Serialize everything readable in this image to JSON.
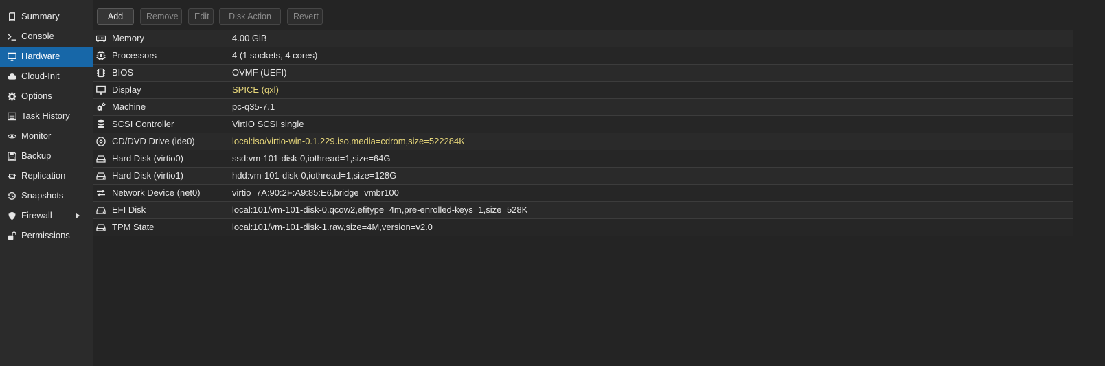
{
  "sidebar": {
    "items": [
      {
        "label": "Summary",
        "icon": "book-icon",
        "active": false
      },
      {
        "label": "Console",
        "icon": "terminal-icon",
        "active": false
      },
      {
        "label": "Hardware",
        "icon": "desktop-icon",
        "active": true
      },
      {
        "label": "Cloud-Init",
        "icon": "cloud-icon",
        "active": false
      },
      {
        "label": "Options",
        "icon": "gear-icon",
        "active": false
      },
      {
        "label": "Task History",
        "icon": "list-icon",
        "active": false
      },
      {
        "label": "Monitor",
        "icon": "eye-icon",
        "active": false
      },
      {
        "label": "Backup",
        "icon": "floppy-icon",
        "active": false
      },
      {
        "label": "Replication",
        "icon": "retweet-icon",
        "active": false
      },
      {
        "label": "Snapshots",
        "icon": "history-icon",
        "active": false
      },
      {
        "label": "Firewall",
        "icon": "shield-icon",
        "active": false
      },
      {
        "label": "Permissions",
        "icon": "unlock-icon",
        "active": false
      }
    ]
  },
  "toolbar": {
    "add_label": "Add",
    "remove_label": "Remove",
    "edit_label": "Edit",
    "disk_action_label": "Disk Action",
    "revert_label": "Revert"
  },
  "hardware": {
    "rows": [
      {
        "name": "Memory",
        "value": "4.00 GiB",
        "icon": "memory-icon",
        "pending": false
      },
      {
        "name": "Processors",
        "value": "4 (1 sockets, 4 cores)",
        "icon": "cpu-icon",
        "pending": false
      },
      {
        "name": "BIOS",
        "value": "OVMF (UEFI)",
        "icon": "chip-icon",
        "pending": false
      },
      {
        "name": "Display",
        "value": "SPICE (qxl)",
        "icon": "monitor-icon",
        "pending": true
      },
      {
        "name": "Machine",
        "value": "pc-q35-7.1",
        "icon": "cogs-icon",
        "pending": false
      },
      {
        "name": "SCSI Controller",
        "value": "VirtIO SCSI single",
        "icon": "database-icon",
        "pending": false
      },
      {
        "name": "CD/DVD Drive (ide0)",
        "value": "local:iso/virtio-win-0.1.229.iso,media=cdrom,size=522284K",
        "icon": "cdrom-icon",
        "pending": true
      },
      {
        "name": "Hard Disk (virtio0)",
        "value": "ssd:vm-101-disk-0,iothread=1,size=64G",
        "icon": "hdd-icon",
        "pending": false
      },
      {
        "name": "Hard Disk (virtio1)",
        "value": "hdd:vm-101-disk-0,iothread=1,size=128G",
        "icon": "hdd-icon",
        "pending": false
      },
      {
        "name": "Network Device (net0)",
        "value": "virtio=7A:90:2F:A9:85:E6,bridge=vmbr100",
        "icon": "exchange-icon",
        "pending": false
      },
      {
        "name": "EFI Disk",
        "value": "local:101/vm-101-disk-0.qcow2,efitype=4m,pre-enrolled-keys=1,size=528K",
        "icon": "hdd-icon",
        "pending": false
      },
      {
        "name": "TPM State",
        "value": "local:101/vm-101-disk-1.raw,size=4M,version=v2.0",
        "icon": "hdd-icon",
        "pending": false
      }
    ]
  },
  "colors": {
    "active_nav": "#1767a8",
    "pending_text": "#e6d67a",
    "background": "#242424"
  }
}
